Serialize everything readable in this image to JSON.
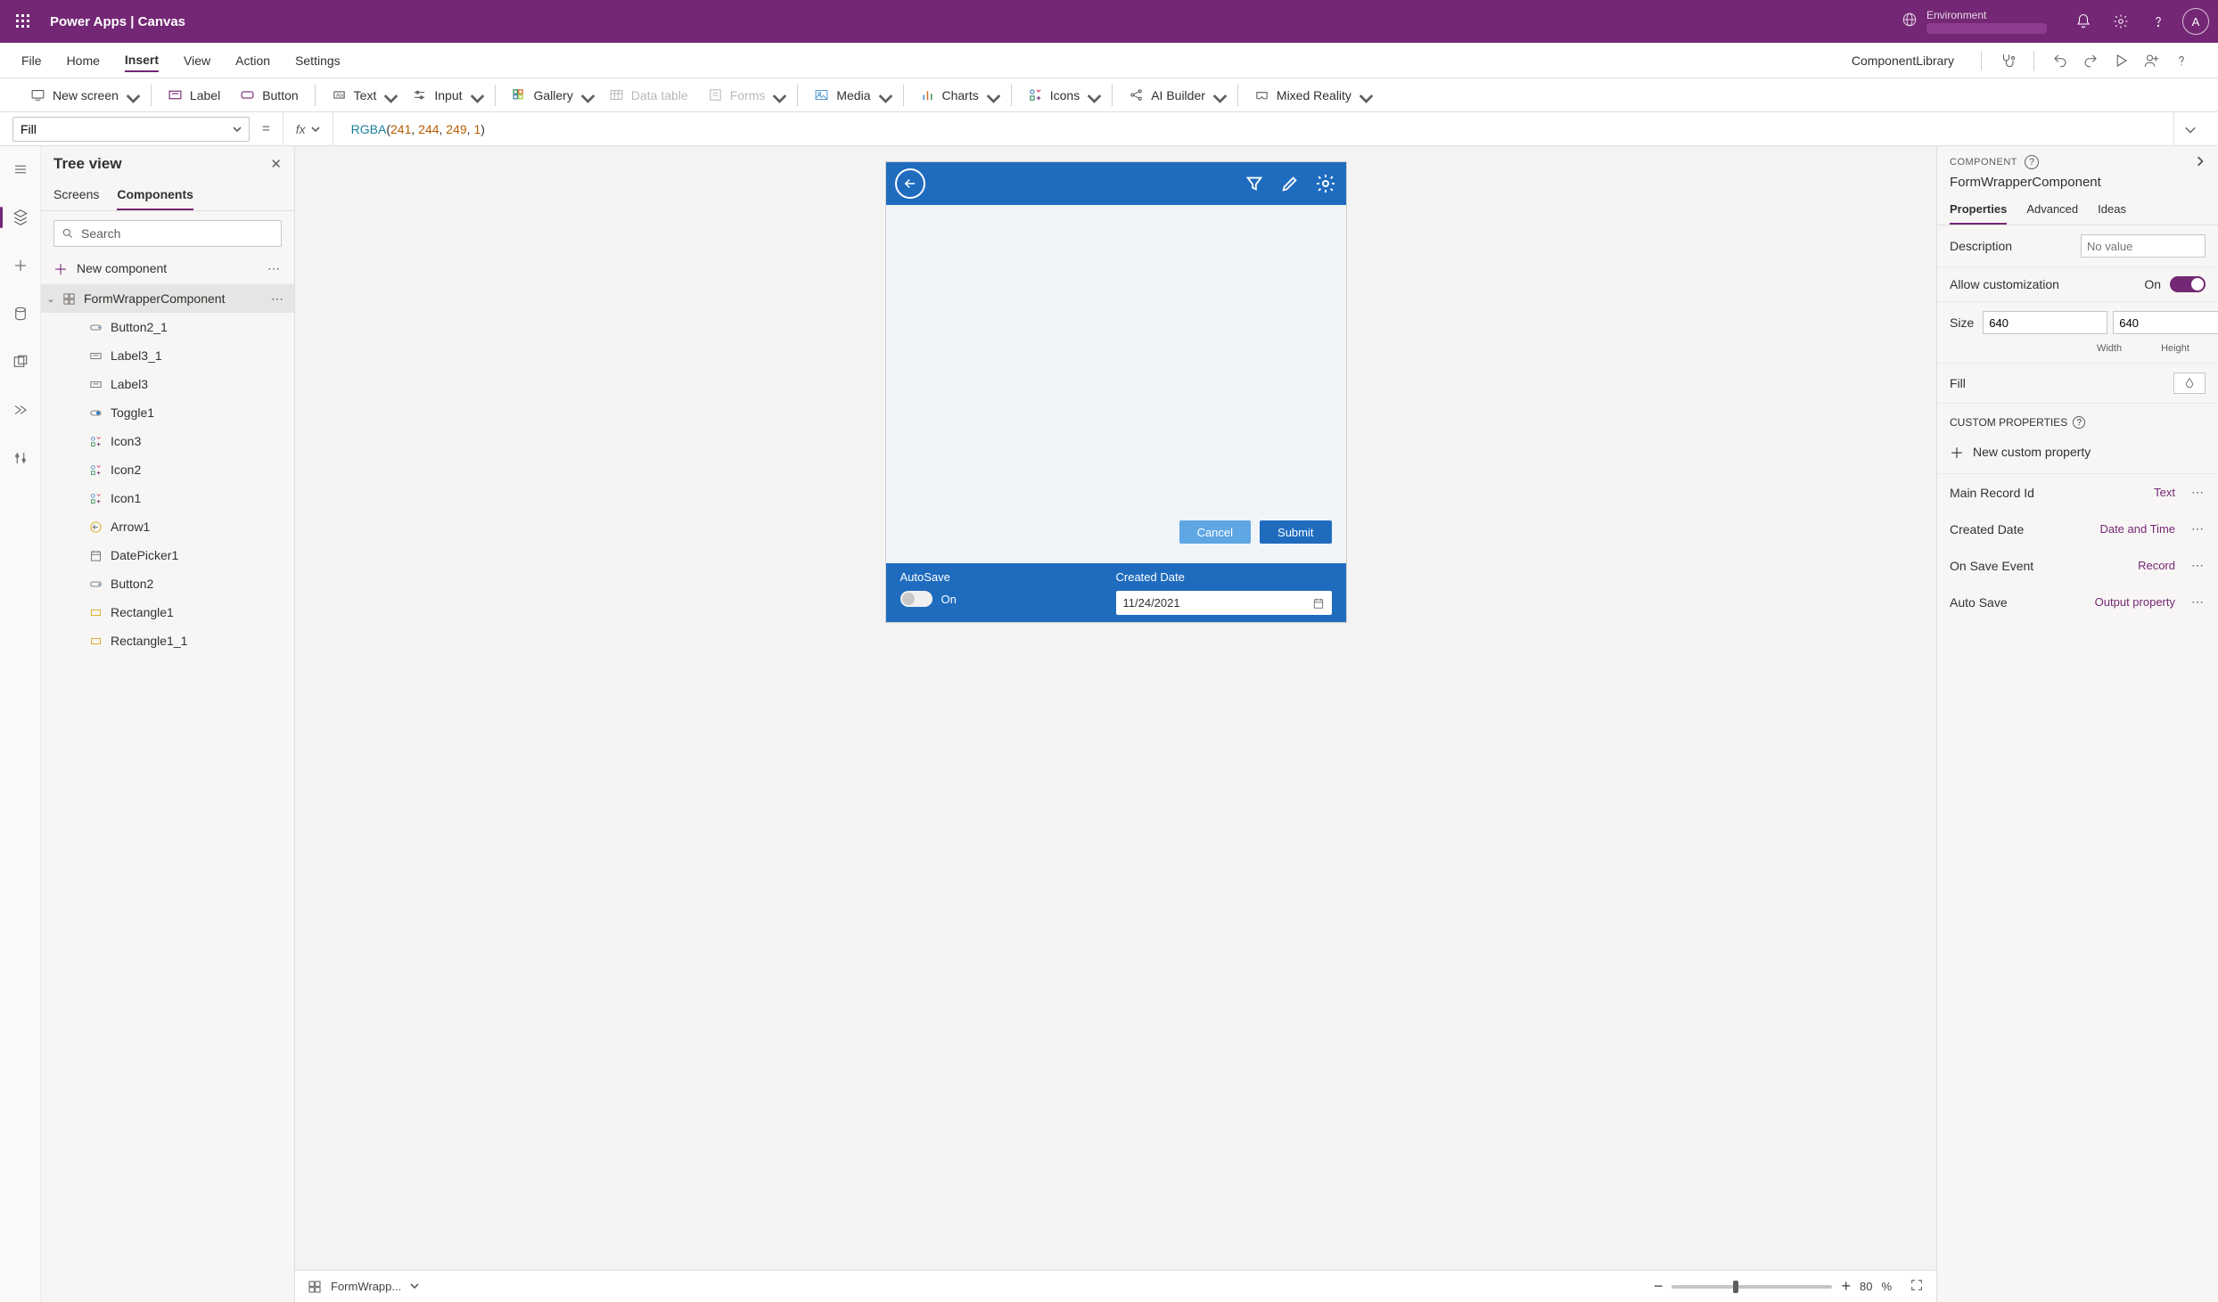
{
  "titlebar": {
    "product": "Power Apps",
    "page": "Canvas",
    "full_title": "Power Apps  |  Canvas",
    "environment_label": "Environment",
    "avatar_initial": "A"
  },
  "menubar": {
    "items": [
      "File",
      "Home",
      "Insert",
      "View",
      "Action",
      "Settings"
    ],
    "active_index": 2,
    "right_link": "ComponentLibrary"
  },
  "ribbon": {
    "new_screen": "New screen",
    "label": "Label",
    "button": "Button",
    "text": "Text",
    "input": "Input",
    "gallery": "Gallery",
    "data_table": "Data table",
    "forms": "Forms",
    "media": "Media",
    "charts": "Charts",
    "icons": "Icons",
    "ai_builder": "AI Builder",
    "mixed_reality": "Mixed Reality"
  },
  "formulabar": {
    "property": "Fill",
    "fx_label": "fx",
    "formula_fn": "RGBA",
    "formula_args": [
      "241",
      "244",
      "249",
      "1"
    ]
  },
  "tree": {
    "title": "Tree view",
    "tabs": [
      "Screens",
      "Components"
    ],
    "active_tab": 1,
    "search_placeholder": "Search",
    "new_component": "New component",
    "root": "FormWrapperComponent",
    "children": [
      {
        "name": "Button2_1",
        "icon": "button"
      },
      {
        "name": "Label3_1",
        "icon": "label"
      },
      {
        "name": "Label3",
        "icon": "label"
      },
      {
        "name": "Toggle1",
        "icon": "toggle"
      },
      {
        "name": "Icon3",
        "icon": "iconctl"
      },
      {
        "name": "Icon2",
        "icon": "iconctl"
      },
      {
        "name": "Icon1",
        "icon": "iconctl"
      },
      {
        "name": "Arrow1",
        "icon": "arrow"
      },
      {
        "name": "DatePicker1",
        "icon": "date"
      },
      {
        "name": "Button2",
        "icon": "button"
      },
      {
        "name": "Rectangle1",
        "icon": "rect"
      },
      {
        "name": "Rectangle1_1",
        "icon": "rect"
      }
    ]
  },
  "canvas": {
    "cancel": "Cancel",
    "submit": "Submit",
    "autosave_label": "AutoSave",
    "autosave_state": "On",
    "created_date_label": "Created Date",
    "created_date_value": "11/24/2021"
  },
  "status": {
    "selector": "FormWrapp...",
    "zoom_value": "80",
    "zoom_unit": "%"
  },
  "props": {
    "header_label": "COMPONENT",
    "name": "FormWrapperComponent",
    "tabs": [
      "Properties",
      "Advanced",
      "Ideas"
    ],
    "active_tab": 0,
    "description_label": "Description",
    "description_placeholder": "No value",
    "allow_custom_label": "Allow customization",
    "allow_custom_state": "On",
    "size_label": "Size",
    "width_value": "640",
    "height_value": "640",
    "width_label": "Width",
    "height_label": "Height",
    "fill_label": "Fill",
    "custom_props_header": "CUSTOM PROPERTIES",
    "new_custom_prop": "New custom property",
    "custom_props": [
      {
        "name": "Main Record Id",
        "type": "Text"
      },
      {
        "name": "Created Date",
        "type": "Date and Time"
      },
      {
        "name": "On Save Event",
        "type": "Record"
      },
      {
        "name": "Auto Save",
        "type": "Output property"
      }
    ]
  }
}
